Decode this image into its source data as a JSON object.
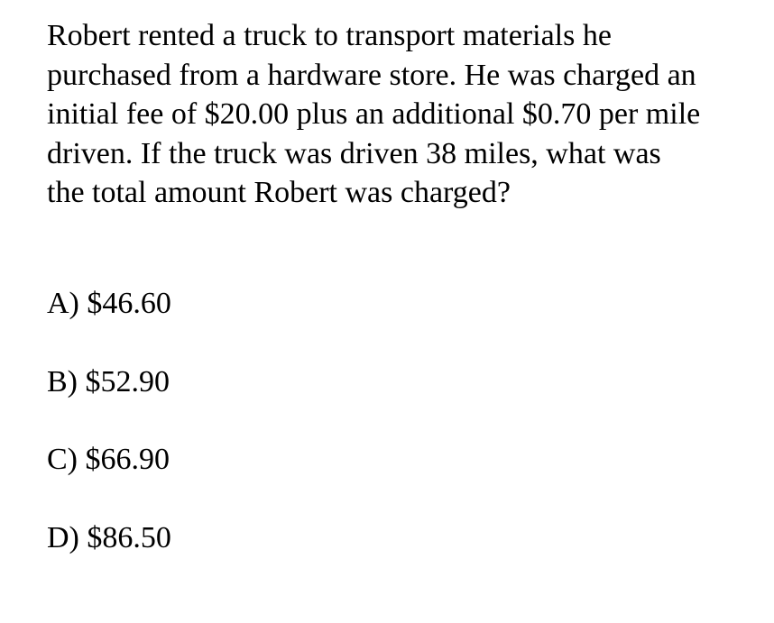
{
  "question": {
    "lines": [
      "Robert rented a truck to transport materials he",
      "purchased from a hardware store. He was charged an",
      "initial fee of $20.00 plus an additional $0.70 per mile",
      "driven. If the truck was driven 38 miles, what was",
      "the total amount Robert was charged?"
    ]
  },
  "choices": [
    {
      "label": "A) $46.60"
    },
    {
      "label": "B) $52.90"
    },
    {
      "label": "C) $66.90"
    },
    {
      "label": "D) $86.50"
    }
  ]
}
